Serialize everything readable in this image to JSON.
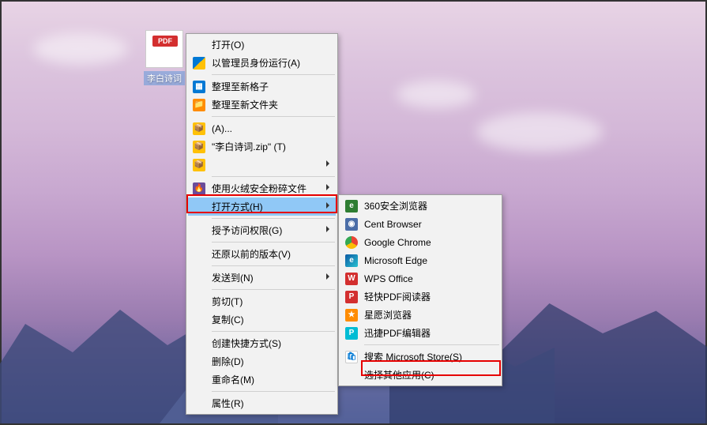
{
  "desktop_icon": {
    "badge": "PDF",
    "label": "李白诗词"
  },
  "context_menu": {
    "open": "打开(O)",
    "run_as_admin": "以管理员身份运行(A)",
    "tidy_new_grid": "整理至新格子",
    "tidy_new_folder": "整理至新文件夹",
    "archive_a": "(A)...",
    "archive_zip": "\"李白诗词.zip\" (T)",
    "shred": "使用火绒安全粉碎文件",
    "open_with": "打开方式(H)",
    "grant_access": "授予访问权限(G)",
    "restore_prev": "还原以前的版本(V)",
    "send_to": "发送到(N)",
    "cut": "剪切(T)",
    "copy": "复制(C)",
    "create_shortcut": "创建快捷方式(S)",
    "delete": "删除(D)",
    "rename": "重命名(M)",
    "properties": "属性(R)"
  },
  "submenu": {
    "items": [
      "360安全浏览器",
      "Cent Browser",
      "Google Chrome",
      "Microsoft Edge",
      "WPS Office",
      "轻快PDF阅读器",
      "星愿浏览器",
      "迅捷PDF编辑器"
    ],
    "search_store": "搜索 Microsoft Store(S)",
    "choose_other": "选择其他应用(C)"
  }
}
